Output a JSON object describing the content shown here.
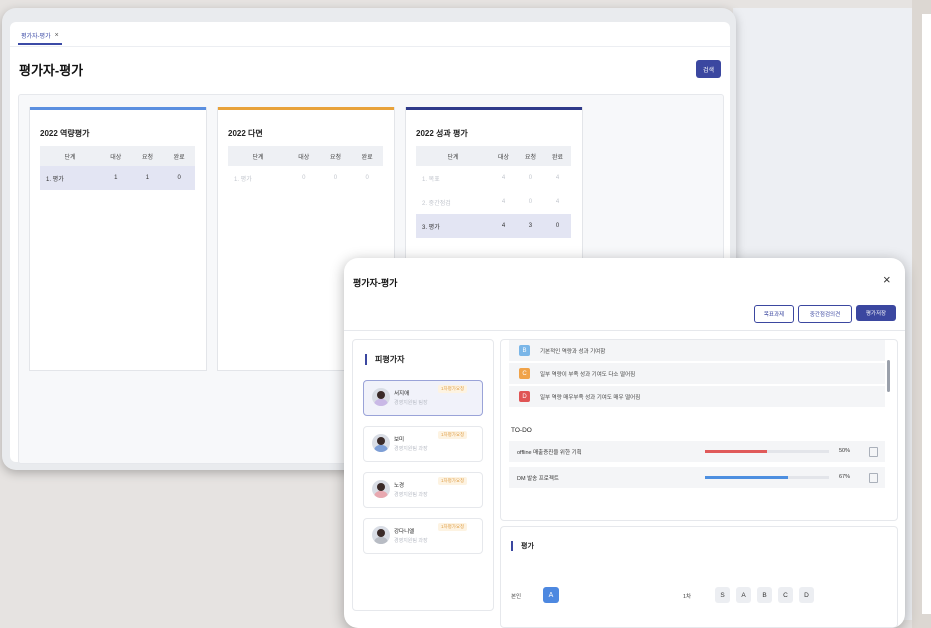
{
  "main": {
    "tab_label": "평가자-평가",
    "tab_close": "×",
    "page_title": "평가자-평가",
    "search_label": "검색",
    "columns": {
      "stage": "단계",
      "target": "대상",
      "request": "요청",
      "done": "완료"
    },
    "cards": [
      {
        "title": "2022 역량평가",
        "color": "#5b8fe0",
        "rows": [
          {
            "label": "1. 평가",
            "target": "1",
            "request": "1",
            "done": "0",
            "state": "active"
          }
        ]
      },
      {
        "title": "2022 다면",
        "color": "#e8a23a",
        "rows": [
          {
            "label": "1. 평가",
            "target": "0",
            "request": "0",
            "done": "0",
            "state": "faded"
          }
        ]
      },
      {
        "title": "2022 성과 평가",
        "color": "#2f3a8a",
        "rows": [
          {
            "label": "1. 목표",
            "target": "4",
            "request": "0",
            "done": "4",
            "state": "faded"
          },
          {
            "label": "2. 중간점검",
            "target": "4",
            "request": "0",
            "done": "4",
            "state": "faded"
          },
          {
            "label": "3. 평가",
            "target": "4",
            "request": "3",
            "done": "0",
            "state": "active"
          }
        ]
      }
    ]
  },
  "modal": {
    "title": "평가자-평가",
    "close": "×",
    "buttons": {
      "goal": "목표과제",
      "mid": "중간점검의견",
      "save": "평가저장"
    },
    "evaluatee_head": "피평가자",
    "evaluatees": [
      {
        "name": "서지애",
        "sub": "경영지원팀 팀장",
        "badge": "1차평가요청",
        "selected": true,
        "body": "#c9b8e6"
      },
      {
        "name": "보미",
        "sub": "경영지원팀 과장",
        "badge": "1차평가요청",
        "selected": false,
        "body": "#7e9fd6"
      },
      {
        "name": "노경",
        "sub": "경영지원팀 과장",
        "badge": "1차평가요청",
        "selected": false,
        "body": "#e8a8b0"
      },
      {
        "name": "강다니엘",
        "sub": "경영지원팀 과장",
        "badge": "1차평가요청",
        "selected": false,
        "body": "#b8bcc4"
      }
    ],
    "grades": [
      {
        "letter": "B",
        "color": "#7ab6e8",
        "text": "기본적인 역량과 성과 기여함"
      },
      {
        "letter": "C",
        "color": "#f0a34a",
        "text": "일부 역량이 부족 성과 기여도 다소 떨어짐"
      },
      {
        "letter": "D",
        "color": "#e05555",
        "text": "일부 역량 매우부족 성과 기여도 매우 떨어짐"
      }
    ],
    "todo_head": "TO-DO",
    "todos": [
      {
        "text": "offline 매출증진을 위한 기획",
        "pct_label": "50%",
        "progress": 0.5,
        "color": "#e05a5a"
      },
      {
        "text": "DM 발송 프로젝트",
        "pct_label": "67%",
        "progress": 0.67,
        "color": "#4d8fe0"
      }
    ],
    "eval_head": "평가",
    "self_label": "본인",
    "self_grade": "A",
    "first_label": "1차",
    "grade_options": [
      "S",
      "A",
      "B",
      "C",
      "D"
    ]
  }
}
